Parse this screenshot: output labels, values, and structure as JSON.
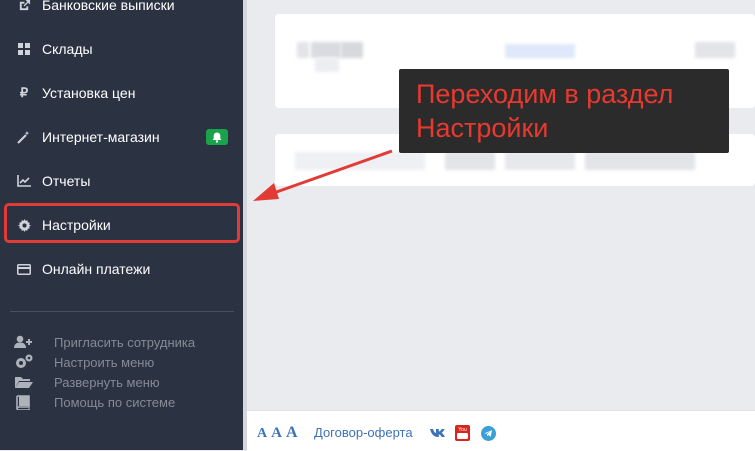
{
  "sidebar": {
    "items": [
      {
        "label": "Банковские выписки",
        "icon": "external-link-icon"
      },
      {
        "label": "Склады",
        "icon": "grid-icon"
      },
      {
        "label": "Установка цен",
        "icon": "ruble-icon"
      },
      {
        "label": "Интернет-магазин",
        "icon": "magic-wand-icon",
        "badge_icon": "bell-icon"
      },
      {
        "label": "Отчеты",
        "icon": "line-chart-icon"
      },
      {
        "label": "Настройки",
        "icon": "gear-icon",
        "active": true
      },
      {
        "label": "Онлайн платежи",
        "icon": "credit-card-icon"
      }
    ],
    "utility": [
      {
        "label": "Пригласить сотрудника",
        "icon": "add-user-icon"
      },
      {
        "label": "Настроить меню",
        "icon": "gears-icon"
      },
      {
        "label": "Развернуть меню",
        "icon": "folder-open-icon"
      },
      {
        "label": "Помощь по системе",
        "icon": "book-icon"
      }
    ]
  },
  "callout": {
    "line1": "Переходим в раздел",
    "line2": "Настройки"
  },
  "footer": {
    "font_size_controls": [
      "A",
      "A",
      "A"
    ],
    "offer_link": "Договор-оферта",
    "social": [
      "vk-icon",
      "youtube-icon",
      "telegram-icon"
    ]
  },
  "colors": {
    "sidebar_bg": "#2b3343",
    "highlight_red": "#e23b36",
    "callout_text": "#e8392f",
    "link_blue": "#3c72b8",
    "badge_green": "#1aa34a"
  }
}
